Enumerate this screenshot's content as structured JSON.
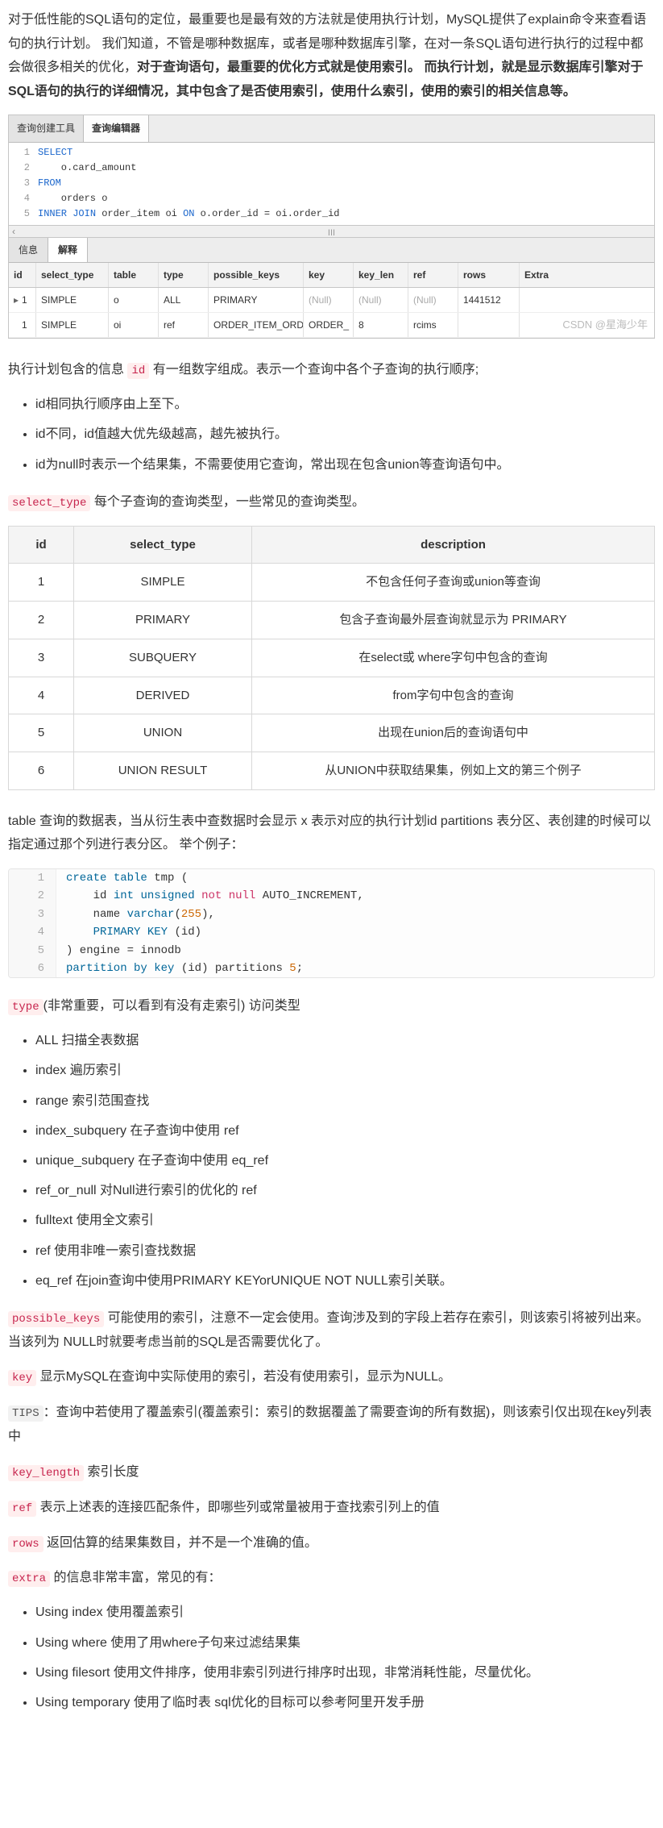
{
  "intro": {
    "p1_plain": "对于低性能的SQL语句的定位，最重要也是最有效的方法就是使用执行计划，MySQL提供了explain命令来查看语句的执行计划。 我们知道，不管是哪种数据库，或者是哪种数据库引擎，在对一条SQL语句进行执行的过程中都会做很多相关的优化，",
    "p1_bold": "对于查询语句，最重要的优化方式就是使用索引。 而执行计划，就是显示数据库引擎对于SQL语句的执行的详细情况，其中包含了是否使用索引，使用什么索引，使用的索引的相关信息等。"
  },
  "editor": {
    "tab1": "查询创建工具",
    "tab2": "查询编辑器",
    "sql": [
      {
        "ln": "1",
        "tokens": [
          "SELECT"
        ]
      },
      {
        "ln": "2",
        "tokens": [
          "    o.card_amount"
        ]
      },
      {
        "ln": "3",
        "tokens": [
          "FROM"
        ]
      },
      {
        "ln": "4",
        "tokens": [
          "    orders o"
        ]
      },
      {
        "ln": "5",
        "tokens": [
          "INNER JOIN order_item oi ON o.order_id = oi.order_id"
        ]
      }
    ],
    "sep": "III",
    "lower_tab1": "信息",
    "lower_tab2": "解释",
    "result_headers": [
      "id",
      "select_type",
      "table",
      "type",
      "possible_keys",
      "key",
      "key_len",
      "ref",
      "rows",
      "Extra"
    ],
    "result_rows": [
      {
        "arrow": "▸",
        "id": "1",
        "st": "SIMPLE",
        "tb": "o",
        "ty": "ALL",
        "pk": "PRIMARY",
        "k": "(Null)",
        "kl": "(Null)",
        "rf": "(Null)",
        "rw": "1441512",
        "ex": ""
      },
      {
        "arrow": "",
        "id": "1",
        "st": "SIMPLE",
        "tb": "oi",
        "ty": "ref",
        "pk": "ORDER_ITEM_ORD",
        "k": "ORDER_",
        "kl": "8",
        "rf": "rcims",
        "rw": "",
        "ex": ""
      }
    ],
    "watermark": "CSDN @星海少年"
  },
  "after_editor": {
    "t1": "执行计划包含的信息 ",
    "code_id": "id",
    "t2": " 有一组数字组成。表示一个查询中各个子查询的执行顺序;",
    "bullets_id": [
      "id相同执行顺序由上至下。",
      "id不同，id值越大优先级越高，越先被执行。",
      "id为null时表示一个结果集，不需要使用它查询，常出现在包含union等查询语句中。"
    ],
    "select_type_code": "select_type",
    "select_type_text": " 每个子查询的查询类型，一些常见的查询类型。"
  },
  "table_select_type": {
    "headers": [
      "id",
      "select_type",
      "description"
    ],
    "rows": [
      [
        "1",
        "SIMPLE",
        "不包含任何子查询或union等查询"
      ],
      [
        "2",
        "PRIMARY",
        "包含子查询最外层查询就显示为 PRIMARY"
      ],
      [
        "3",
        "SUBQUERY",
        "在select或 where字句中包含的查询"
      ],
      [
        "4",
        "DERIVED",
        "from字句中包含的查询"
      ],
      [
        "5",
        "UNION",
        "出现在union后的查询语句中"
      ],
      [
        "6",
        "UNION RESULT",
        "从UNION中获取结果集，例如上文的第三个例子"
      ]
    ]
  },
  "table_para": "table 查询的数据表，当从衍生表中查数据时会显示 x 表示对应的执行计划id partitions 表分区、表创建的时候可以指定通过那个列进行表分区。 举个例子：",
  "codeblock_lines": [
    "create table tmp (",
    "    id int unsigned not null AUTO_INCREMENT,",
    "    name varchar(255),",
    "    PRIMARY KEY (id)",
    ") engine = innodb",
    "partition by key (id) partitions 5;"
  ],
  "type_code": "type",
  "type_text": "(非常重要，可以看到有没有走索引) 访问类型",
  "type_bullets": [
    "ALL 扫描全表数据",
    "index 遍历索引",
    "range 索引范围查找",
    "index_subquery 在子查询中使用 ref",
    "unique_subquery 在子查询中使用 eq_ref",
    "ref_or_null 对Null进行索引的优化的 ref",
    "fulltext 使用全文索引",
    "ref 使用非唯一索引查找数据",
    "eq_ref 在join查询中使用PRIMARY KEYorUNIQUE NOT NULL索引关联。"
  ],
  "possible_keys_code": "possible_keys",
  "possible_keys_text": " 可能使用的索引，注意不一定会使用。查询涉及到的字段上若存在索引，则该索引将被列出来。当该列为 NULL时就要考虑当前的SQL是否需要优化了。",
  "key_code": "key",
  "key_text": " 显示MySQL在查询中实际使用的索引，若没有使用索引，显示为NULL。",
  "tips_label": "TIPS",
  "tips_text": "：查询中若使用了覆盖索引(覆盖索引：索引的数据覆盖了需要查询的所有数据)，则该索引仅出现在key列表中",
  "key_length_code": "key_length",
  "key_length_text": " 索引长度",
  "ref_code": "ref",
  "ref_text": " 表示上述表的连接匹配条件，即哪些列或常量被用于查找索引列上的值",
  "rows_code": "rows",
  "rows_text": " 返回估算的结果集数目，并不是一个准确的值。",
  "extra_code": "extra",
  "extra_text": " 的信息非常丰富，常见的有：",
  "extra_bullets": [
    "Using index 使用覆盖索引",
    "Using where 使用了用where子句来过滤结果集",
    "Using filesort 使用文件排序，使用非索引列进行排序时出现，非常消耗性能，尽量优化。",
    "Using temporary 使用了临时表 sql优化的目标可以参考阿里开发手册"
  ]
}
